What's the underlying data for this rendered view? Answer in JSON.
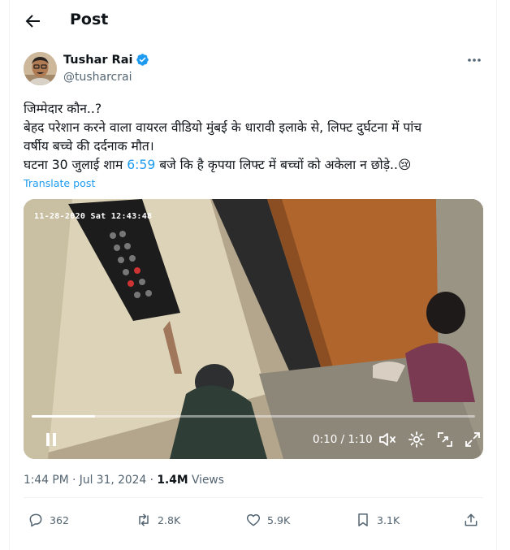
{
  "header": {
    "title": "Post",
    "back_icon": "arrow-left-icon"
  },
  "author": {
    "name": "Tushar Rai",
    "handle": "@tusharcrai",
    "verified_color": "#1d9bf0"
  },
  "post": {
    "lines": [
      "जिम्मेदार कौन..?",
      "बेहद परेशान करने वाला वायरल वीडियो मुंबई के धारावी इलाके से, लिफ्ट दुर्घटना में पांच",
      "वर्षीय बच्चे की दर्दनाक मौत।"
    ],
    "last_line_before": "घटना 30 जुलाई शाम ",
    "last_line_link": "6:59",
    "last_line_after": " बजे कि है कृपया लिफ्ट में बच्चों को अकेला न छोड़े..😢",
    "translate": "Translate post"
  },
  "video": {
    "stamp": "11-28-2020 Sat 12:43:48",
    "current_time": "0:10",
    "duration": "1:10",
    "time_display": "0:10 / 1:10",
    "progress_fraction": 0.143
  },
  "meta": {
    "time": "1:44 PM",
    "sep1": " · ",
    "date": "Jul 31, 2024",
    "sep2": " · ",
    "views_count": "1.4M",
    "views_label": " Views"
  },
  "actions": {
    "replies": "362",
    "reposts": "2.8K",
    "likes": "5.9K",
    "bookmarks": "3.1K"
  },
  "colors": {
    "accent": "#1d9bf0",
    "muted": "#536471",
    "text": "#0f1419"
  }
}
